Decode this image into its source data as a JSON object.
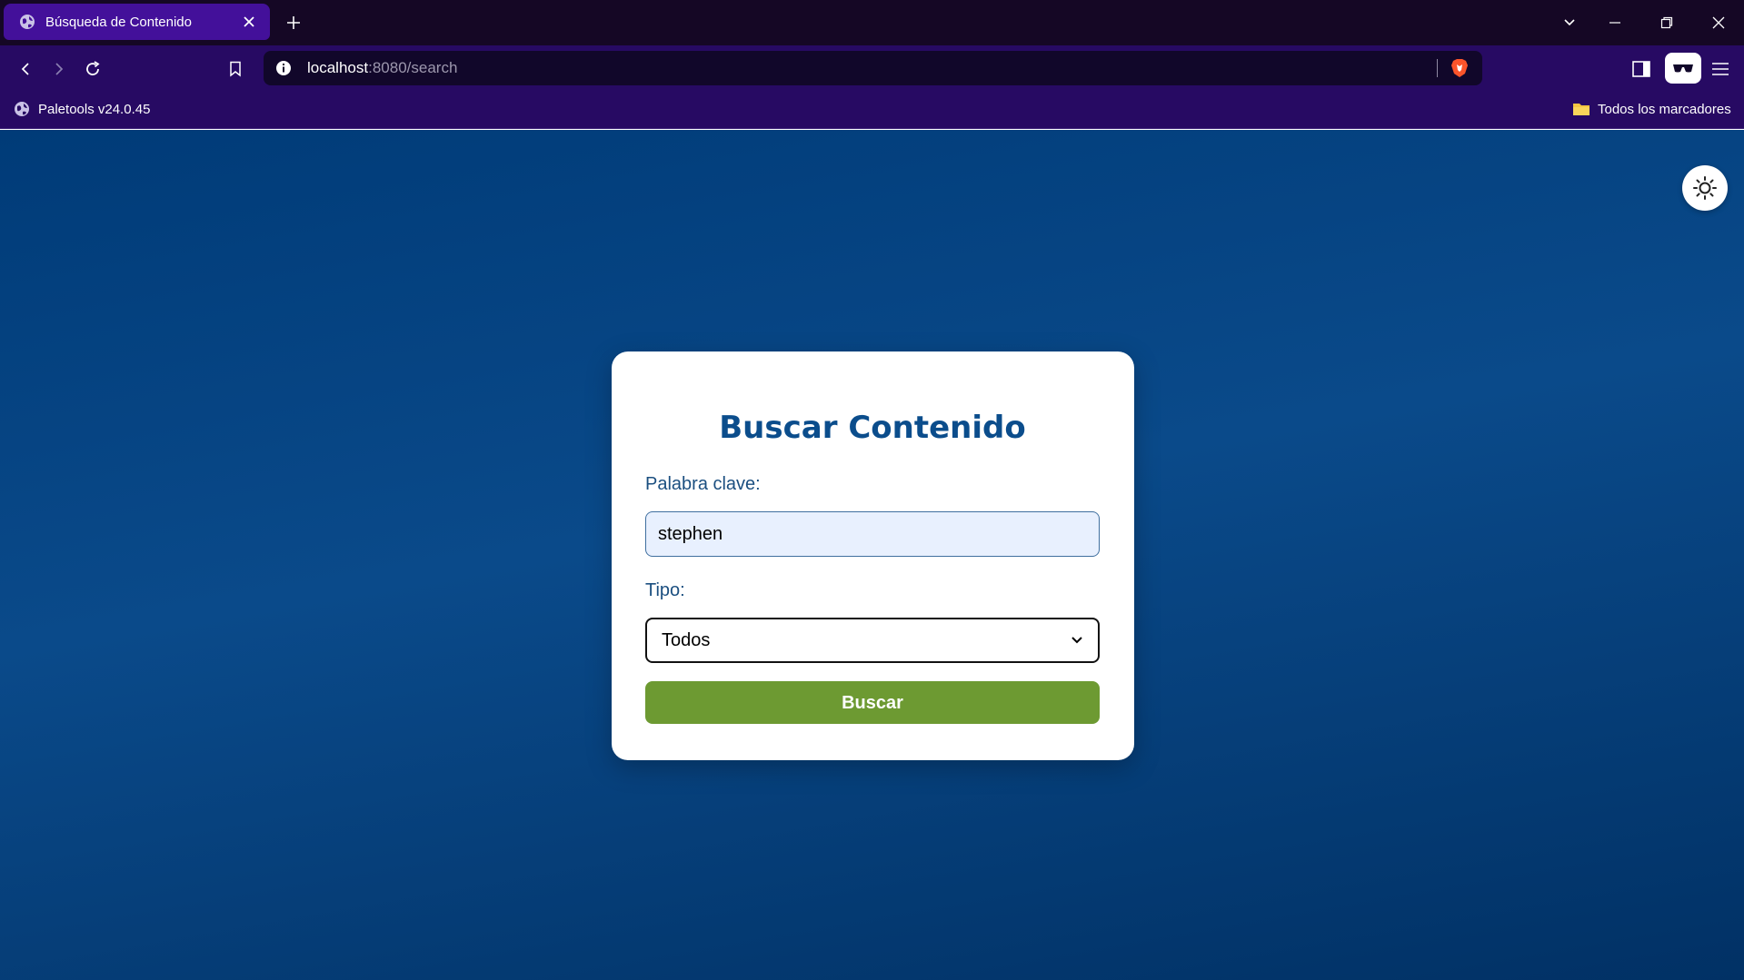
{
  "browser": {
    "tab": {
      "title": "Búsqueda de Contenido"
    },
    "address": {
      "host": "localhost",
      "path": ":8080/search"
    },
    "bookmarks": [
      {
        "label": "Paletools v24.0.45"
      },
      {
        "label": "Todos los marcadores"
      }
    ]
  },
  "page": {
    "title": "Buscar Contenido",
    "keyword": {
      "label": "Palabra clave:",
      "value": "stephen"
    },
    "type": {
      "label": "Tipo:",
      "selected": "Todos"
    },
    "submit_label": "Buscar"
  },
  "colors": {
    "tabstrip": "#150725",
    "toolbar": "#270a63",
    "active_tab": "#43109a",
    "page_bg": "#0a4a8a",
    "card_title": "#0b4d8c",
    "submit_bg": "#6d9a32"
  },
  "icons": {
    "tab": "globe-icon",
    "theme_toggle": "sun-icon",
    "shield": "brave-shield-icon",
    "bookmark_folder": "folder-icon"
  }
}
